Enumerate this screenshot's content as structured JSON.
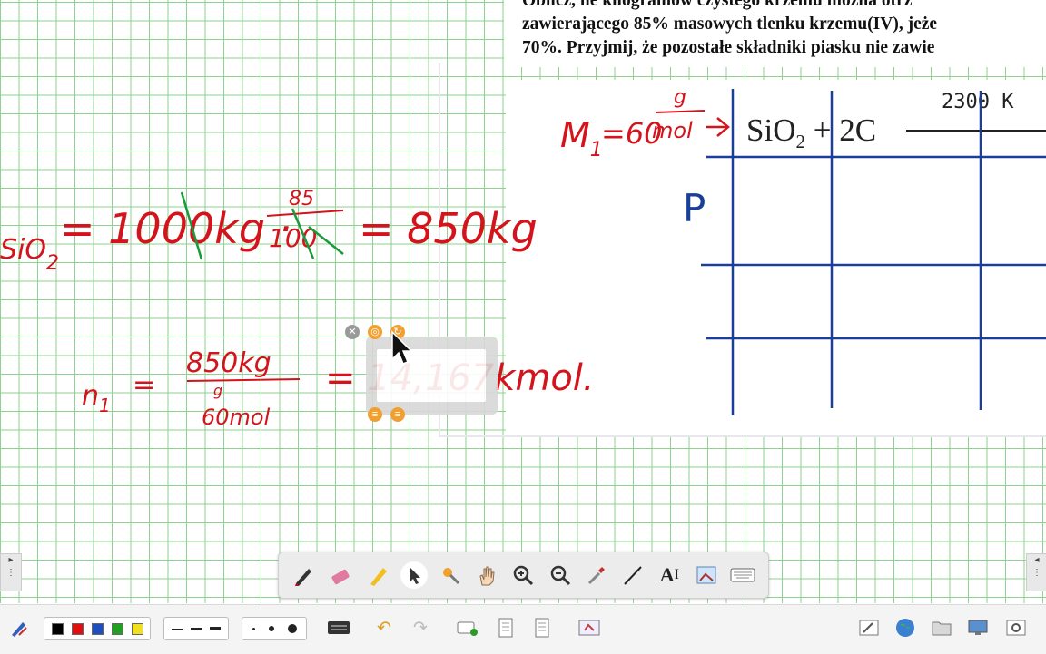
{
  "task": {
    "line1": "Oblicz, ile kilogramów czystego krzemu można otrz",
    "line2": "zawierającego 85% masowych tlenku krzemu(IV), jeże",
    "line3": "70%. Przyjmij, że pozostałe składniki piasku nie zawie"
  },
  "equation": {
    "formula_pre": "SiO",
    "formula_sub": "2",
    "formula_post": " + 2C",
    "temperature": "2300 K"
  },
  "ink": {
    "sio2_label": "SiO",
    "sio2_sub": "2",
    "mass_expr": "= 1000kg · ",
    "frac_num": "85",
    "frac_den": "100",
    "mass_result": "= 850kg",
    "molar_mass": "M",
    "molar_mass_sub": "1",
    "molar_mass_value": "=60",
    "molar_mass_num": "g",
    "molar_mass_den": "mol",
    "p_label": "P",
    "n_label": "n",
    "n_sub": "1",
    "n_eq": "=",
    "n_num": "850kg",
    "n_den_num": "g",
    "n_den": "60mol",
    "n_result": "= 14,167kmol."
  },
  "toolbar": {
    "tools": [
      "pen-icon",
      "eraser-icon",
      "highlighter-icon",
      "select-icon",
      "laser-pointer-icon",
      "hand-icon",
      "zoom-in-icon",
      "zoom-out-icon",
      "pipette-icon",
      "line-icon",
      "text-icon",
      "capture-icon",
      "keyboard-icon"
    ],
    "text_tool_label": "A",
    "text_tool_sub": "I"
  },
  "bottombar": {
    "colors": [
      "#000000",
      "#e01010",
      "#1f4fbf",
      "#22a022",
      "#f0e020"
    ],
    "line_styles": [
      "thin",
      "medium",
      "thick"
    ],
    "point_sizes": [
      "small",
      "medium",
      "large"
    ]
  },
  "colors": {
    "ink_red": "#d4141c",
    "ink_green": "#1a9a3a",
    "table_blue": "#1a3f9a",
    "grid": "#8fd18f"
  }
}
